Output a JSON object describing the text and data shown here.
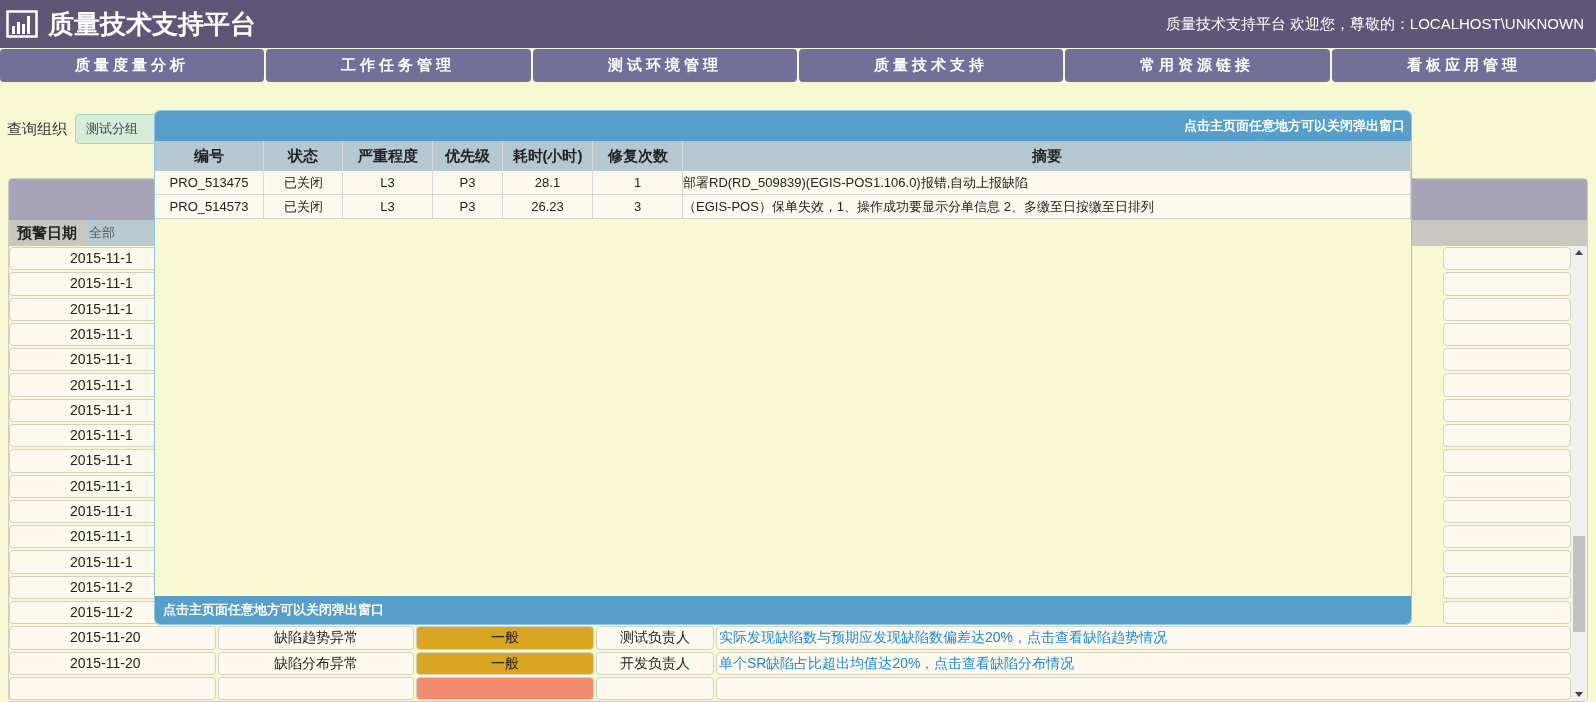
{
  "header": {
    "title": "质量技术支持平台",
    "welcome": "质量技术支持平台 欢迎您，尊敬的：LOCALHOST\\UNKNOWN"
  },
  "nav": [
    "质量度量分析",
    "工作任务管理",
    "测试环境管理",
    "质量技术支持",
    "常用资源链接",
    "看板应用管理"
  ],
  "query": {
    "label": "查询组织",
    "value": "测试分组"
  },
  "alerts": {
    "filter_label": "预警日期",
    "filter_value": "全部",
    "rows": [
      {
        "date": "2015-11-1"
      },
      {
        "date": "2015-11-1"
      },
      {
        "date": "2015-11-1"
      },
      {
        "date": "2015-11-1"
      },
      {
        "date": "2015-11-1"
      },
      {
        "date": "2015-11-1"
      },
      {
        "date": "2015-11-1"
      },
      {
        "date": "2015-11-1"
      },
      {
        "date": "2015-11-1"
      },
      {
        "date": "2015-11-1"
      },
      {
        "date": "2015-11-1"
      },
      {
        "date": "2015-11-1"
      },
      {
        "date": "2015-11-1"
      },
      {
        "date": "2015-11-2"
      },
      {
        "date": "2015-11-2"
      },
      {
        "date": "2015-11-20",
        "type": "缺陷趋势异常",
        "severity": "一般",
        "color": "#daa520",
        "owner": "测试负责人",
        "description": "实际发现缺陷数与预期应发现缺陷数偏差达20%，点击查看缺陷趋势情况"
      },
      {
        "date": "2015-11-20",
        "type": "缺陷分布异常",
        "severity": "一般",
        "color": "#daa520",
        "owner": "开发负责人",
        "description": "单个SR缺陷占比超出均值达20%，点击查看缺陷分布情况"
      },
      {
        "color": "#f08a70"
      }
    ]
  },
  "popup": {
    "top_note": "**点击主页面**任意地方可以关闭弹出窗口",
    "columns": [
      "编号",
      "状态",
      "严重程度",
      "优先级",
      "耗时(小时)",
      "修复次数",
      "摘要"
    ],
    "rows": [
      [
        "PRO_513475",
        "已关闭",
        "L3",
        "P3",
        "28.1",
        "1",
        "部署RD(RD_509839)(EGIS-POS1.106.0)报错,自动上报缺陷"
      ],
      [
        "PRO_514573",
        "已关闭",
        "L3",
        "P3",
        "26.23",
        "3",
        "（EGIS-POS）保单失效，1、操作成功要显示分单信息 2、多缴至日按缴至日排列"
      ]
    ],
    "bottom_note": "**点击主页面**任意地方可以关闭弹出窗口"
  }
}
